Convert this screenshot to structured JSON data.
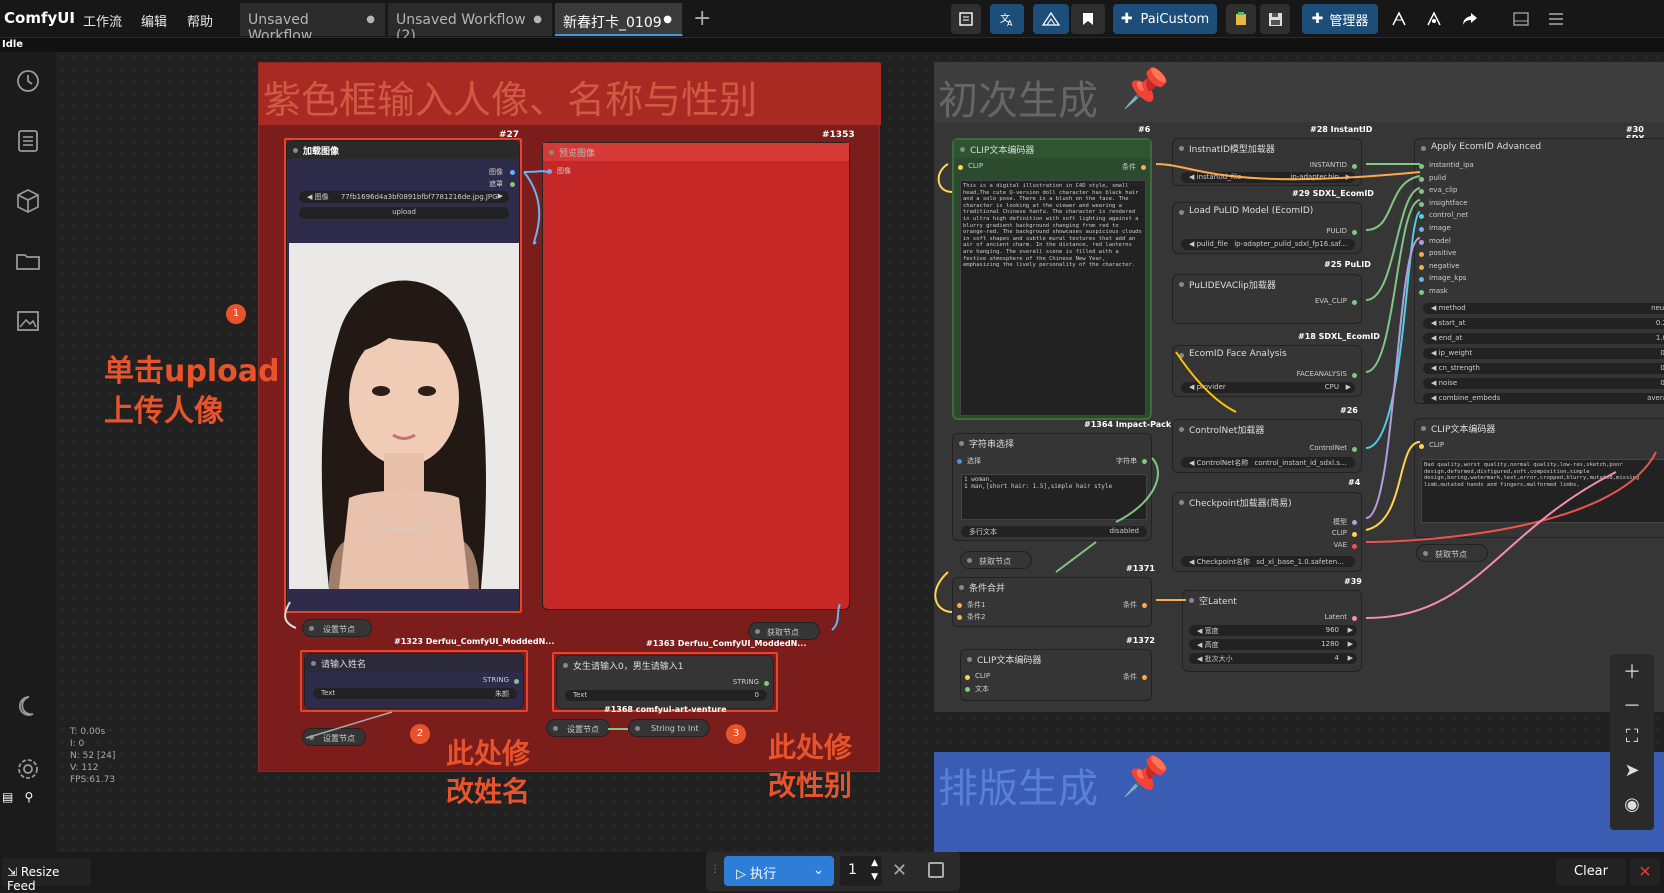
{
  "app": {
    "name": "ComfyUI",
    "status": "Idle"
  },
  "menu": {
    "workflow": "工作流",
    "edit": "编辑",
    "help": "帮助"
  },
  "tabs": [
    {
      "label": "Unsaved Workflow",
      "marker": "●"
    },
    {
      "label": "Unsaved Workflow (2)",
      "marker": "●"
    },
    {
      "label": "新春打卡_0109",
      "marker": "●"
    }
  ],
  "add_tab": "+",
  "toolbar": {
    "paicustom": "PaiCustom",
    "manager": "管理器"
  },
  "colors": {
    "red_group": "#7a1d1b",
    "red_title": "#a82a22",
    "gray_group": "#3a3a3a",
    "blue_group": "#3a5db3",
    "annotation": "#e8532c",
    "accent": "#4a90e2"
  },
  "groups": {
    "red_title": "紫色框输入人像、名称与性别",
    "first_gen": "初次生成",
    "layout_gen": "排版生成",
    "pin_icon": "📌"
  },
  "annotations": {
    "upload_1": "单击upload",
    "upload_2": "上传人像",
    "name_1": "此处修",
    "name_2": "改姓名",
    "gender_1": "此处修",
    "gender_2": "改性别",
    "badge_1": "1",
    "badge_2": "2",
    "badge_3": "3"
  },
  "nodes": {
    "load_image": {
      "id": "#27",
      "title": "加载图像",
      "out1": "图像",
      "out2": "遮罩",
      "file_label": "图像",
      "file": "77fb1696d4a3bf0891bfbf7781216de.jpg.JPG",
      "upload": "upload"
    },
    "preview": {
      "id": "#1353",
      "title": "预览图像",
      "in1": "图像"
    },
    "set_node1": "设置节点",
    "set_node2": "设置节点",
    "set_node3": "设置节点",
    "get_node1": "获取节点",
    "name_input": {
      "id": "#1323 Derfuu_ComfyUI_ModdedN...",
      "title": "请输入姓名",
      "out": "STRING",
      "label": "Text",
      "value": "朱颜"
    },
    "gender_input": {
      "id": "#1363 Derfuu_ComfyUI_ModdedN...",
      "title": "女生请输入0，男生请输入1",
      "out": "STRING",
      "label": "Text",
      "value": "0"
    },
    "string_to_int": {
      "id": "#1368 comfyui-art-venture",
      "title": "String to Int"
    },
    "clip_text1": {
      "id": "#6",
      "title": "CLIP文本编码器",
      "in": "CLIP",
      "out": "条件",
      "text": "This is a digital illustration in C4D style, small head,The cute Q-version doll character has black hair and a solo pose. There is a blush on the face. The character is looking at the viewer and wearing a traditional Chinese hanfu. The character is rendered in ultra high definition with soft lighting against a blurry gradient background changing from red to orange-red. The background showcases auspicious clouds in soft shapes and subtle mural textures that add an air of ancient charm. In the distance, red lanterns are hanging. The overall scene is filled with a festive atmosphere of the Chinese New Year, emphasizing the lively personality of the character."
    },
    "instantid_loader": {
      "id": "#28 InstantID",
      "title": "InstnatID模型加载器",
      "out": "INSTANTID",
      "w_label": "instantid_file",
      "w_value": "ip-adapter.bin"
    },
    "pulid_loader": {
      "id": "#29 SDXL_EcomID",
      "title": "Load PuLID Model (EcomID)",
      "out": "PULID",
      "w_label": "pulid_file",
      "w_value": "ip-adapter_pulid_sdxl_fp16.saf..."
    },
    "pulid_eva": {
      "id": "#25 PuLID",
      "title": "PuLIDEVAClip加载器",
      "out": "EVA_CLIP"
    },
    "face_analysis": {
      "id": "#18 SDXL_EcomID",
      "title": "EcomID Face Analysis",
      "out": "FACEANALYSIS",
      "w_label": "provider",
      "w_value": "CPU"
    },
    "string_select": {
      "id": "#1364 Impact-Pack",
      "title": "字符串选择",
      "in": "选择",
      "out": "字符串",
      "text1": "1 woman,",
      "text2": "1 man,[short hair: 1.5],simple hair style",
      "multiline": "多行文本",
      "disabled": "disabled"
    },
    "controlnet": {
      "id": "#26",
      "title": "ControlNet加载器",
      "out": "ControlNet",
      "w_label": "ControlNet名称",
      "w_value": "control_instant_id_sdxl.s..."
    },
    "checkpoint": {
      "id": "#4",
      "title": "Checkpoint加载器(简易)",
      "out1": "模型",
      "out2": "CLIP",
      "out3": "VAE",
      "w_label": "Checkpoint名称",
      "w_value": "sd_xl_base_1.0.safeten..."
    },
    "get_node2": "获取节点",
    "get_node3": "获取节点",
    "cond_merge": {
      "id": "#1371",
      "title": "条件合并",
      "in1": "条件1",
      "in2": "条件2",
      "out": "条件"
    },
    "empty_latent": {
      "id": "#39",
      "title": "空Latent",
      "out": "Latent",
      "w1_label": "宽度",
      "w1": "960",
      "w2_label": "高度",
      "w2": "1280",
      "w3_label": "批次大小",
      "w3": "4"
    },
    "clip_text2": {
      "id": "#1372",
      "title": "CLIP文本编码器",
      "in1": "CLIP",
      "in2": "文本",
      "out": "条件"
    },
    "apply_ecomid": {
      "id": "#30 SDX",
      "title": "Apply EcomID Advanced",
      "inputs": [
        "instantid_ipa",
        "pulid",
        "eva_clip",
        "insightface",
        "control_net",
        "image",
        "model",
        "positive",
        "negative",
        "image_kps",
        "mask"
      ],
      "widgets": [
        [
          "method",
          "neut"
        ],
        [
          "start_at",
          "0.2"
        ],
        [
          "end_at",
          "1.0"
        ],
        [
          "ip_weight",
          "0."
        ],
        [
          "cn_strength",
          "0."
        ],
        [
          "noise",
          "0."
        ],
        [
          "combine_embeds",
          "avera"
        ]
      ]
    },
    "clip_text3": {
      "title": "CLIP文本编码器",
      "in": "CLIP",
      "text": "Bad quality,worst quality,normal quality,low-res,sketch,poor design,deformed,disfigured,soft,composition,simple design,boring,watermark,text,error,cropped,blurry,mutated,missing limb,mutated hands and fingers,malformed limbs,"
    }
  },
  "stats": {
    "t": "T: 0.00s",
    "i": "I: 0",
    "n": "N: 52 [24]",
    "v": "V: 112",
    "fps": "FPS:61.73"
  },
  "bottom": {
    "resize_feed": "Resize Feed",
    "run": "执行",
    "count": "1",
    "clear": "Clear"
  }
}
